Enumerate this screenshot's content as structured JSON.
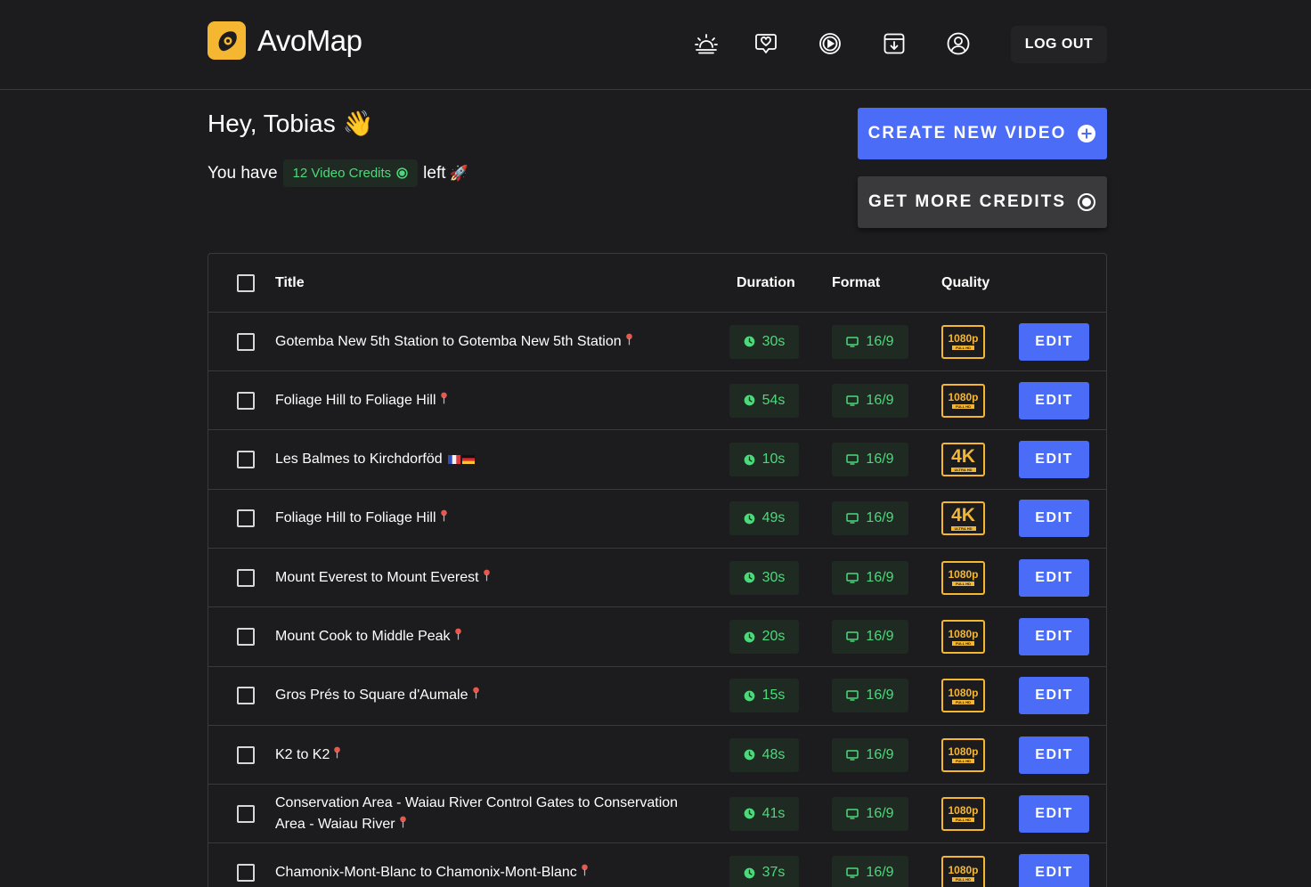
{
  "brand": {
    "name": "AvoMap",
    "accent": "#f5b731",
    "primary": "#4a6cf7",
    "green": "#4cd97b"
  },
  "nav": {
    "icons": [
      "sunrise-icon",
      "heart-chat-icon",
      "play-circle-icon",
      "download-box-icon",
      "user-circle-icon"
    ],
    "logout_label": "LOG OUT"
  },
  "greeting": {
    "text": "Hey, Tobias",
    "emoji": "👋"
  },
  "credits": {
    "prefix": "You have",
    "badge": "12 Video Credits",
    "suffix": "left",
    "emoji": "🚀"
  },
  "actions": {
    "create_label": "CREATE NEW VIDEO",
    "credits_label": "GET MORE CREDITS"
  },
  "table": {
    "headers": {
      "title": "Title",
      "duration": "Duration",
      "format": "Format",
      "quality": "Quality"
    },
    "edit_label": "EDIT",
    "rows": [
      {
        "title": "Gotemba New 5th Station to Gotemba New 5th Station",
        "marker": "pin",
        "duration": "30s",
        "format": "16/9",
        "quality": "1080p",
        "quality_sub": "FULL HD"
      },
      {
        "title": "Foliage Hill to Foliage Hill",
        "marker": "pin",
        "duration": "54s",
        "format": "16/9",
        "quality": "1080p",
        "quality_sub": "FULL HD"
      },
      {
        "title": "Les Balmes to Kirchdorföd",
        "marker": "flags",
        "duration": "10s",
        "format": "16/9",
        "quality": "4K",
        "quality_sub": "ULTRA HD"
      },
      {
        "title": "Foliage Hill to Foliage Hill",
        "marker": "pin",
        "duration": "49s",
        "format": "16/9",
        "quality": "4K",
        "quality_sub": "ULTRA HD"
      },
      {
        "title": "Mount Everest to Mount Everest",
        "marker": "pin",
        "duration": "30s",
        "format": "16/9",
        "quality": "1080p",
        "quality_sub": "FULL HD"
      },
      {
        "title": "Mount Cook to Middle Peak",
        "marker": "pin",
        "duration": "20s",
        "format": "16/9",
        "quality": "1080p",
        "quality_sub": "FULL HD"
      },
      {
        "title": "Gros Prés to Square d'Aumale",
        "marker": "pin",
        "duration": "15s",
        "format": "16/9",
        "quality": "1080p",
        "quality_sub": "FULL HD"
      },
      {
        "title": "K2 to K2",
        "marker": "pin",
        "duration": "48s",
        "format": "16/9",
        "quality": "1080p",
        "quality_sub": "FULL HD"
      },
      {
        "title": "Conservation Area - Waiau River Control Gates to Conservation Area - Waiau River",
        "marker": "pin",
        "duration": "41s",
        "format": "16/9",
        "quality": "1080p",
        "quality_sub": "FULL HD"
      },
      {
        "title": "Chamonix-Mont-Blanc to Chamonix-Mont-Blanc",
        "marker": "pin",
        "duration": "37s",
        "format": "16/9",
        "quality": "1080p",
        "quality_sub": "FULL HD"
      }
    ]
  }
}
